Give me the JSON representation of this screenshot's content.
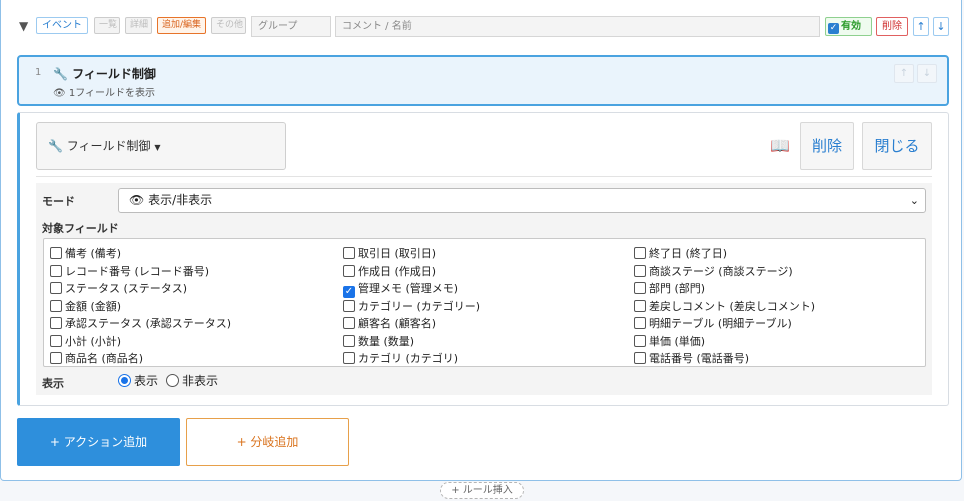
{
  "header": {
    "collapse_icon": "▼",
    "tags": {
      "event": "イベント",
      "list": "一覧",
      "detail": "詳細",
      "add_edit": "追加/編集",
      "other": "その他"
    },
    "group_placeholder": "グループ",
    "comment_placeholder": "コメント / 名前",
    "valid_label": "有効",
    "delete_label": "削除",
    "up_arrow": "↑",
    "down_arrow": "↓"
  },
  "rule": {
    "number": "1",
    "title": "フィールド制御",
    "title_icon": "wrench-icon",
    "summary": "1フィールドを表示",
    "summary_icon": "eye-icon",
    "up_arrow": "↑",
    "down_arrow": "↓"
  },
  "editor": {
    "action_type": "フィールド制御",
    "delete_label": "削除",
    "close_label": "閉じる",
    "mode_label": "モード",
    "mode_value": "表示/非表示",
    "target_label": "対象フィールド",
    "fields": [
      {
        "label": "備考 (備考)",
        "checked": false
      },
      {
        "label": "レコード番号 (レコード番号)",
        "checked": false
      },
      {
        "label": "ステータス (ステータス)",
        "checked": false
      },
      {
        "label": "金額 (金額)",
        "checked": false
      },
      {
        "label": "承認ステータス (承認ステータス)",
        "checked": false
      },
      {
        "label": "小計 (小計)",
        "checked": false
      },
      {
        "label": "商品名 (商品名)",
        "checked": false
      },
      {
        "label": "取引日 (取引日)",
        "checked": false
      },
      {
        "label": "作成日 (作成日)",
        "checked": false
      },
      {
        "label": "管理メモ (管理メモ)",
        "checked": true
      },
      {
        "label": "カテゴリー (カテゴリー)",
        "checked": false
      },
      {
        "label": "顧客名 (顧客名)",
        "checked": false
      },
      {
        "label": "数量 (数量)",
        "checked": false
      },
      {
        "label": "カテゴリ (カテゴリ)",
        "checked": false
      },
      {
        "label": "終了日 (終了日)",
        "checked": false
      },
      {
        "label": "商談ステージ (商談ステージ)",
        "checked": false
      },
      {
        "label": "部門 (部門)",
        "checked": false
      },
      {
        "label": "差戻しコメント (差戻しコメント)",
        "checked": false
      },
      {
        "label": "明細テーブル (明細テーブル)",
        "checked": false
      },
      {
        "label": "単価 (単価)",
        "checked": false
      },
      {
        "label": "電話番号 (電話番号)",
        "checked": false
      }
    ],
    "display_label": "表示",
    "display_options": [
      {
        "label": "表示",
        "selected": true
      },
      {
        "label": "非表示",
        "selected": false
      }
    ]
  },
  "footer": {
    "add_action": "+ アクション追加",
    "add_branch": "+ 分岐追加",
    "insert_rule": "+ ルール挿入"
  },
  "colors": {
    "accent": "#2e8fdc",
    "branch": "#d9721c",
    "delete": "#d03030",
    "valid": "#2a9b2a"
  }
}
